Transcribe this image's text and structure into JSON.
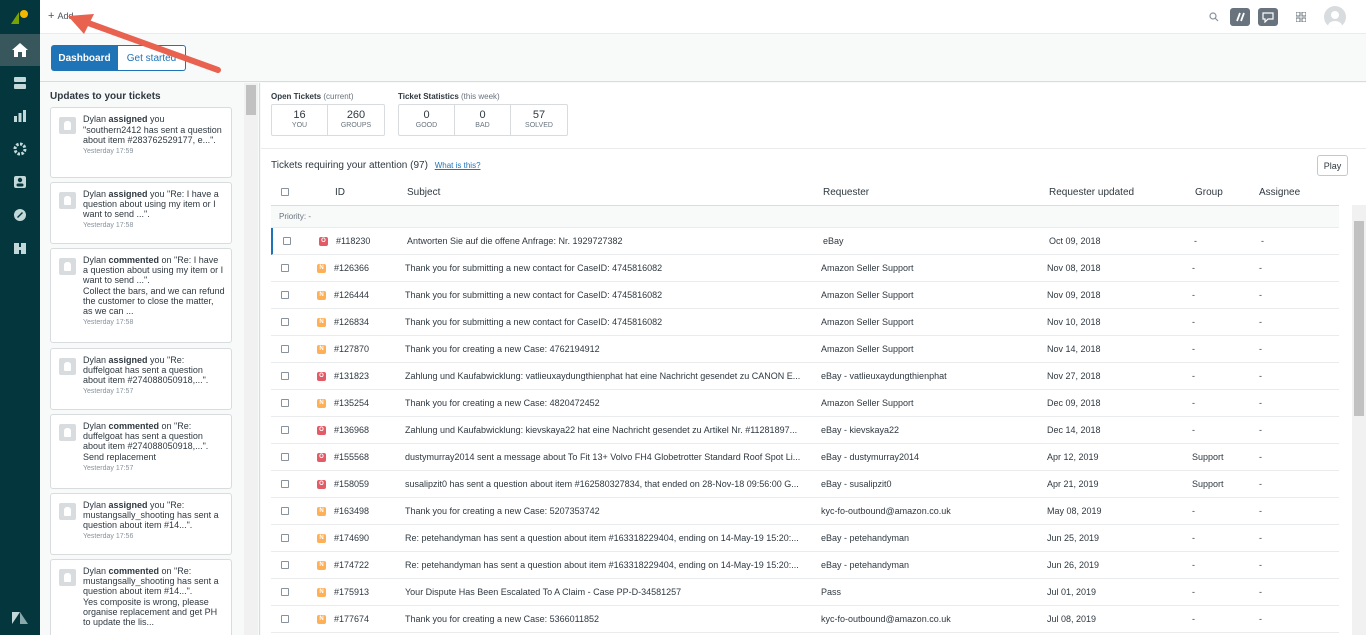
{
  "topbar": {
    "add_label": "Add"
  },
  "tabs": {
    "dashboard": "Dashboard",
    "get_started": "Get started"
  },
  "updates": {
    "title": "Updates to your tickets",
    "items": [
      {
        "user": "Dylan",
        "verb": "assigned",
        "rest": " you",
        "body": "\"southern2412 has sent a question about item #283762529177, e...\".",
        "time": "Yesterday 17:59"
      },
      {
        "user": "Dylan",
        "verb": "assigned",
        "rest": " you \"Re: I have a question about using my item or I want to send ...\".",
        "body": "",
        "time": "Yesterday 17:58"
      },
      {
        "user": "Dylan",
        "verb": "commented",
        "rest": " on \"Re: I have a question about using my item or I want to send ...\".",
        "body": "Collect the bars, and we can refund the customer to close the matter, as we can ...",
        "time": "Yesterday 17:58"
      },
      {
        "user": "Dylan",
        "verb": "assigned",
        "rest": " you \"Re: duffelgoat has sent a question about item #274088050918,...\".",
        "body": "",
        "time": "Yesterday 17:57"
      },
      {
        "user": "Dylan",
        "verb": "commented",
        "rest": " on \"Re: duffelgoat has sent a question about item #274088050918,...\".",
        "body": "Send replacement",
        "time": "Yesterday 17:57"
      },
      {
        "user": "Dylan",
        "verb": "assigned",
        "rest": " you \"Re: mustangsally_shooting has sent a question about item #14...\".",
        "body": "",
        "time": "Yesterday 17:56"
      },
      {
        "user": "Dylan",
        "verb": "commented",
        "rest": " on \"Re: mustangsally_shooting has sent a question about item #14...\".",
        "body": "Yes composite is wrong, please organise replacement and get PH to update the lis...",
        "time": ""
      }
    ]
  },
  "stats": {
    "open_title": "Open Tickets",
    "open_sub": "(current)",
    "open": [
      {
        "num": "16",
        "label": "YOU"
      },
      {
        "num": "260",
        "label": "GROUPS"
      }
    ],
    "ticket_title": "Ticket Statistics",
    "ticket_sub": "(this week)",
    "ticket": [
      {
        "num": "0",
        "label": "GOOD"
      },
      {
        "num": "0",
        "label": "BAD"
      },
      {
        "num": "57",
        "label": "SOLVED"
      }
    ]
  },
  "attention": {
    "title": "Tickets requiring your attention",
    "count": "(97)",
    "what": "What is this?",
    "play": "Play"
  },
  "table": {
    "headers": {
      "id": "ID",
      "subject": "Subject",
      "requester": "Requester",
      "updated": "Requester updated",
      "group": "Group",
      "assignee": "Assignee"
    },
    "priority_label": "Priority: -",
    "rows": [
      {
        "badge": "O",
        "id": "#118230",
        "subject": "Antworten Sie auf die offene Anfrage: Nr. 1929727382",
        "requester": "eBay",
        "updated": "Oct 09, 2018",
        "group": "-",
        "assignee": "-"
      },
      {
        "badge": "N",
        "id": "#126366",
        "subject": "Thank you for submitting a new contact for CaseID: 4745816082",
        "requester": "Amazon Seller Support",
        "updated": "Nov 08, 2018",
        "group": "-",
        "assignee": "-"
      },
      {
        "badge": "N",
        "id": "#126444",
        "subject": "Thank you for submitting a new contact for CaseID: 4745816082",
        "requester": "Amazon Seller Support",
        "updated": "Nov 09, 2018",
        "group": "-",
        "assignee": "-"
      },
      {
        "badge": "N",
        "id": "#126834",
        "subject": "Thank you for submitting a new contact for CaseID: 4745816082",
        "requester": "Amazon Seller Support",
        "updated": "Nov 10, 2018",
        "group": "-",
        "assignee": "-"
      },
      {
        "badge": "N",
        "id": "#127870",
        "subject": "Thank you for creating a new Case: 4762194912",
        "requester": "Amazon Seller Support",
        "updated": "Nov 14, 2018",
        "group": "-",
        "assignee": "-"
      },
      {
        "badge": "O",
        "id": "#131823",
        "subject": "Zahlung und Kaufabwicklung: vatlieuxaydungthienphat hat eine Nachricht gesendet zu CANON E...",
        "requester": "eBay - vatlieuxaydungthienphat",
        "updated": "Nov 27, 2018",
        "group": "-",
        "assignee": "-"
      },
      {
        "badge": "N",
        "id": "#135254",
        "subject": "Thank you for creating a new Case: 4820472452",
        "requester": "Amazon Seller Support",
        "updated": "Dec 09, 2018",
        "group": "-",
        "assignee": "-"
      },
      {
        "badge": "O",
        "id": "#136968",
        "subject": "Zahlung und Kaufabwicklung: kievskaya22 hat eine Nachricht gesendet zu Artikel Nr. #11281897...",
        "requester": "eBay - kievskaya22",
        "updated": "Dec 14, 2018",
        "group": "-",
        "assignee": "-"
      },
      {
        "badge": "O",
        "id": "#155568",
        "subject": "dustymurray2014 sent a message about To Fit 13+ Volvo FH4 Globetrotter Standard Roof Spot Li...",
        "requester": "eBay - dustymurray2014",
        "updated": "Apr 12, 2019",
        "group": "Support",
        "assignee": "-"
      },
      {
        "badge": "O",
        "id": "#158059",
        "subject": "susalipzit0 has sent a question about item #162580327834, that ended on 28-Nov-18 09:56:00 G...",
        "requester": "eBay - susalipzit0",
        "updated": "Apr 21, 2019",
        "group": "Support",
        "assignee": "-"
      },
      {
        "badge": "N",
        "id": "#163498",
        "subject": "Thank you for creating a new Case: 5207353742",
        "requester": "kyc-fo-outbound@amazon.co.uk",
        "updated": "May 08, 2019",
        "group": "-",
        "assignee": "-"
      },
      {
        "badge": "N",
        "id": "#174690",
        "subject": "Re: petehandyman has sent a question about item #163318229404, ending on 14-May-19 15:20:...",
        "requester": "eBay - petehandyman",
        "updated": "Jun 25, 2019",
        "group": "-",
        "assignee": "-"
      },
      {
        "badge": "N",
        "id": "#174722",
        "subject": "Re: petehandyman has sent a question about item #163318229404, ending on 14-May-19 15:20:...",
        "requester": "eBay - petehandyman",
        "updated": "Jun 26, 2019",
        "group": "-",
        "assignee": "-"
      },
      {
        "badge": "N",
        "id": "#175913",
        "subject": "Your Dispute Has Been Escalated To A Claim - Case PP-D-34581257",
        "requester": "Pass",
        "updated": "Jul 01, 2019",
        "group": "-",
        "assignee": "-"
      },
      {
        "badge": "N",
        "id": "#177674",
        "subject": "Thank you for creating a new Case: 5366011852",
        "requester": "kyc-fo-outbound@amazon.co.uk",
        "updated": "Jul 08, 2019",
        "group": "-",
        "assignee": "-"
      }
    ]
  },
  "icons": {
    "nav": [
      "home-icon",
      "views-icon",
      "reporting-icon",
      "admin-gear-icon",
      "customers-icon",
      "zendesk-brand-icon",
      "organizations-icon"
    ],
    "top": [
      "search-icon",
      "talk-icon",
      "chat-icon",
      "apps-grid-icon"
    ]
  },
  "colors": {
    "nav_bg": "#03363d",
    "accent": "#1f73b7",
    "badge_open": "#e35b66",
    "badge_new": "#ffb057",
    "arrow": "#e8624f"
  }
}
